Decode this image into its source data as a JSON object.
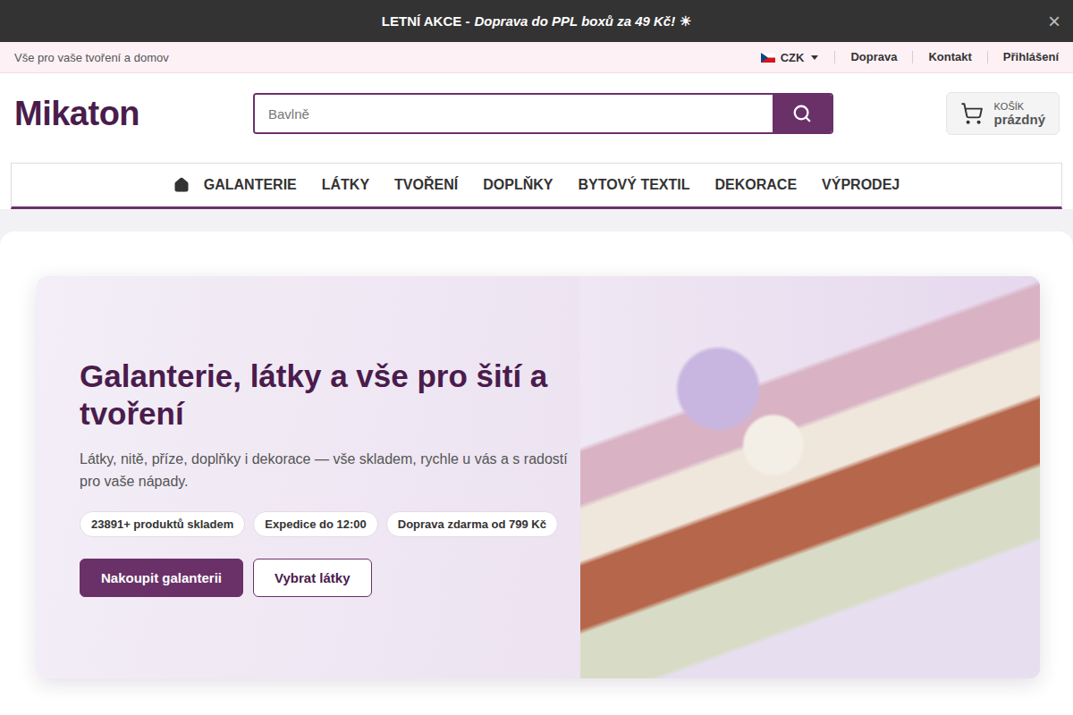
{
  "announcement": {
    "title": "LETNÍ AKCE -",
    "highlight": "Doprava do PPL boxů za 49 Kč!",
    "emoji": "☀",
    "close": "×"
  },
  "topbar": {
    "tagline": "Vše pro vaše tvoření a domov",
    "currency": "CZK",
    "links": [
      "Doprava",
      "Kontakt",
      "Přihlášení"
    ]
  },
  "header": {
    "logo": "Mikaton",
    "search": {
      "placeholder": "Bavlně"
    },
    "cart": {
      "label": "KOŠÍK",
      "status": "prázdný"
    }
  },
  "nav": [
    "GALANTERIE",
    "LÁTKY",
    "TVOŘENÍ",
    "DOPLŇKY",
    "BYTOVÝ TEXTIL",
    "DEKORACE",
    "VÝPRODEJ"
  ],
  "hero": {
    "title": "Galanterie, látky a vše pro šití a tvoření",
    "text": "Látky, nitě, příze, doplňky i dekorace — vše skladem, rychle u vás a s radostí pro vaše nápady.",
    "badges": [
      "23891+ produktů skladem",
      "Expedice do 12:00",
      "Doprava zdarma od 799 Kč"
    ],
    "buttons": [
      {
        "label": "Nakoupit galanterii",
        "kind": "primary"
      },
      {
        "label": "Vybrat látky",
        "kind": "secondary"
      }
    ]
  }
}
